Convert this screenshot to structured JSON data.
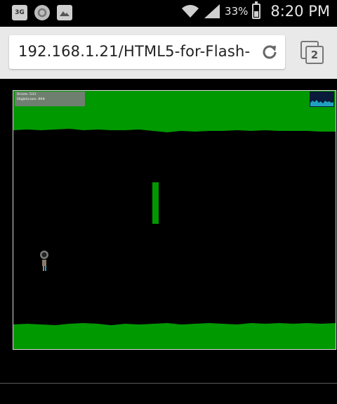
{
  "status_bar": {
    "network_label": "3G",
    "battery_percent": "33%",
    "time": "8:20 PM"
  },
  "browser": {
    "url": "192.168.1.21/HTML5-for-Flash-",
    "tab_count": "2"
  },
  "game": {
    "score_line": "Score: 533",
    "highscore_line": "HighScore: 904",
    "colors": {
      "terrain": "#009900",
      "background": "#000000"
    }
  }
}
